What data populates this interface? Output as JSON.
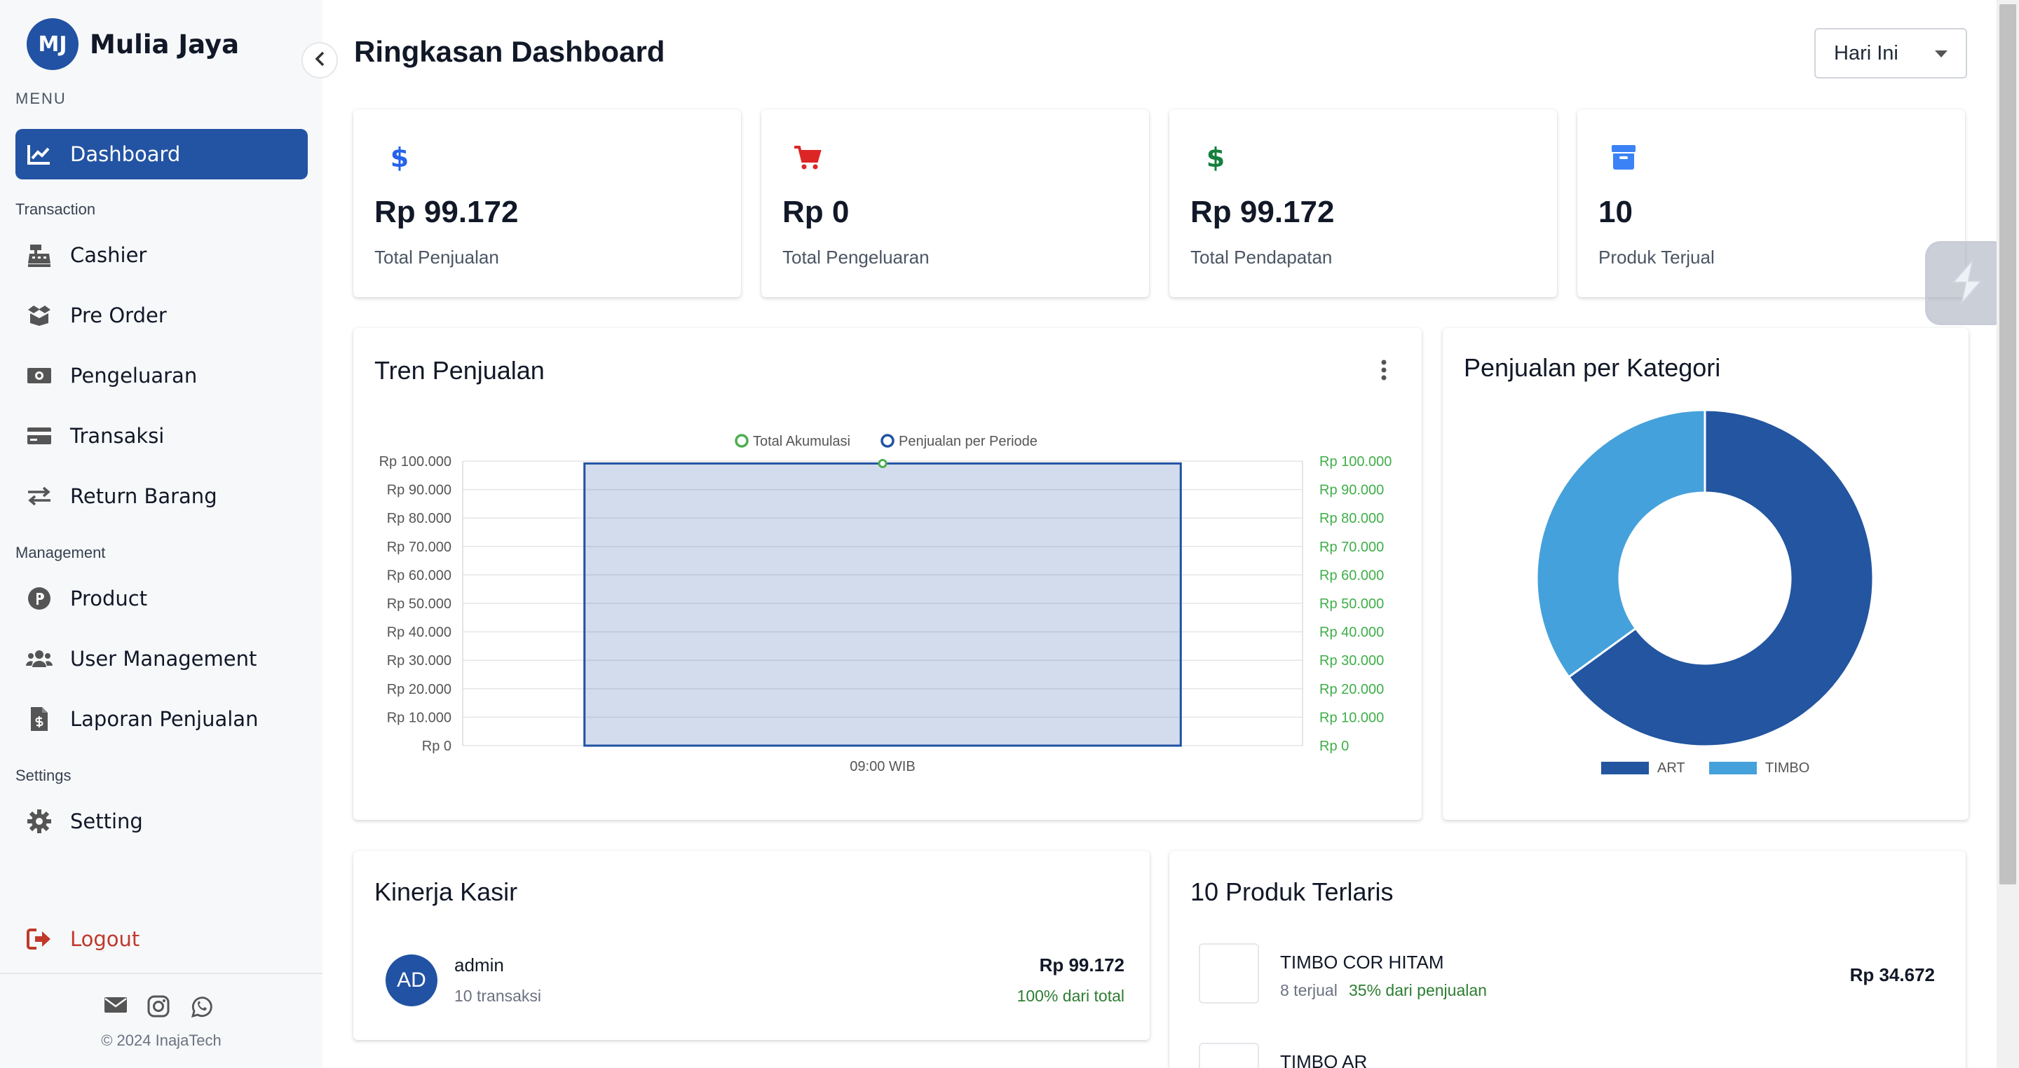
{
  "brand": {
    "initials": "MJ",
    "name": "Mulia Jaya"
  },
  "sidebar": {
    "menu_label": "MENU",
    "dashboard": "Dashboard",
    "transaction_label": "Transaction",
    "cashier": "Cashier",
    "pre_order": "Pre Order",
    "pengeluaran": "Pengeluaran",
    "transaksi": "Transaksi",
    "return_barang": "Return Barang",
    "management_label": "Management",
    "product": "Product",
    "user_management": "User Management",
    "laporan_penjualan": "Laporan Penjualan",
    "settings_label": "Settings",
    "setting": "Setting",
    "logout": "Logout",
    "copyright": "© 2024 InajaTech"
  },
  "header": {
    "title": "Ringkasan Dashboard",
    "period_selected": "Hari Ini"
  },
  "stats": [
    {
      "value": "Rp 99.172",
      "label": "Total Penjualan",
      "icon": "dollar-icon",
      "color": "#2563eb"
    },
    {
      "value": "Rp 0",
      "label": "Total Pengeluaran",
      "icon": "cart-icon",
      "color": "#dc2626"
    },
    {
      "value": "Rp 99.172",
      "label": "Total Pendapatan",
      "icon": "dollar-icon",
      "color": "#15803d"
    },
    {
      "value": "10",
      "label": "Produk Terjual",
      "icon": "archive-icon",
      "color": "#3b82f6"
    }
  ],
  "trend": {
    "title": "Tren Penjualan"
  },
  "category": {
    "title": "Penjualan per Kategori"
  },
  "chart_data": [
    {
      "type": "bar",
      "title": "Tren Penjualan",
      "categories": [
        "09:00 WIB"
      ],
      "series": [
        {
          "name": "Total Akumulasi",
          "type": "line",
          "values": [
            99172
          ],
          "color": "#4caf50",
          "axis": "right"
        },
        {
          "name": "Penjualan per Periode",
          "type": "bar",
          "values": [
            99172
          ],
          "color": "#2152a3",
          "axis": "left"
        }
      ],
      "ylim": [
        0,
        100000
      ],
      "yticks": [
        "Rp 0",
        "Rp 10.000",
        "Rp 20.000",
        "Rp 30.000",
        "Rp 40.000",
        "Rp 50.000",
        "Rp 60.000",
        "Rp 70.000",
        "Rp 80.000",
        "Rp 90.000",
        "Rp 100.000"
      ],
      "legend": "top",
      "grid": true
    },
    {
      "type": "pie",
      "title": "Penjualan per Kategori",
      "categories": [
        "ART",
        "TIMBO"
      ],
      "values": [
        65,
        35
      ],
      "colors": [
        "#2355a0",
        "#45a1dc"
      ],
      "legend": "bottom"
    }
  ],
  "cashier_perf": {
    "title": "Kinerja Kasir",
    "rows": [
      {
        "initials": "AD",
        "name": "admin",
        "transactions": "10 transaksi",
        "amount": "Rp 99.172",
        "share": "100% dari total"
      }
    ]
  },
  "top_products": {
    "title": "10 Produk Terlaris",
    "rows": [
      {
        "name": "TIMBO COR HITAM",
        "sold": "8 terjual",
        "share": "35% dari penjualan",
        "amount": "Rp 34.672"
      },
      {
        "name": "TIMBO AR",
        "sold": "",
        "share": "",
        "amount": ""
      }
    ]
  }
}
